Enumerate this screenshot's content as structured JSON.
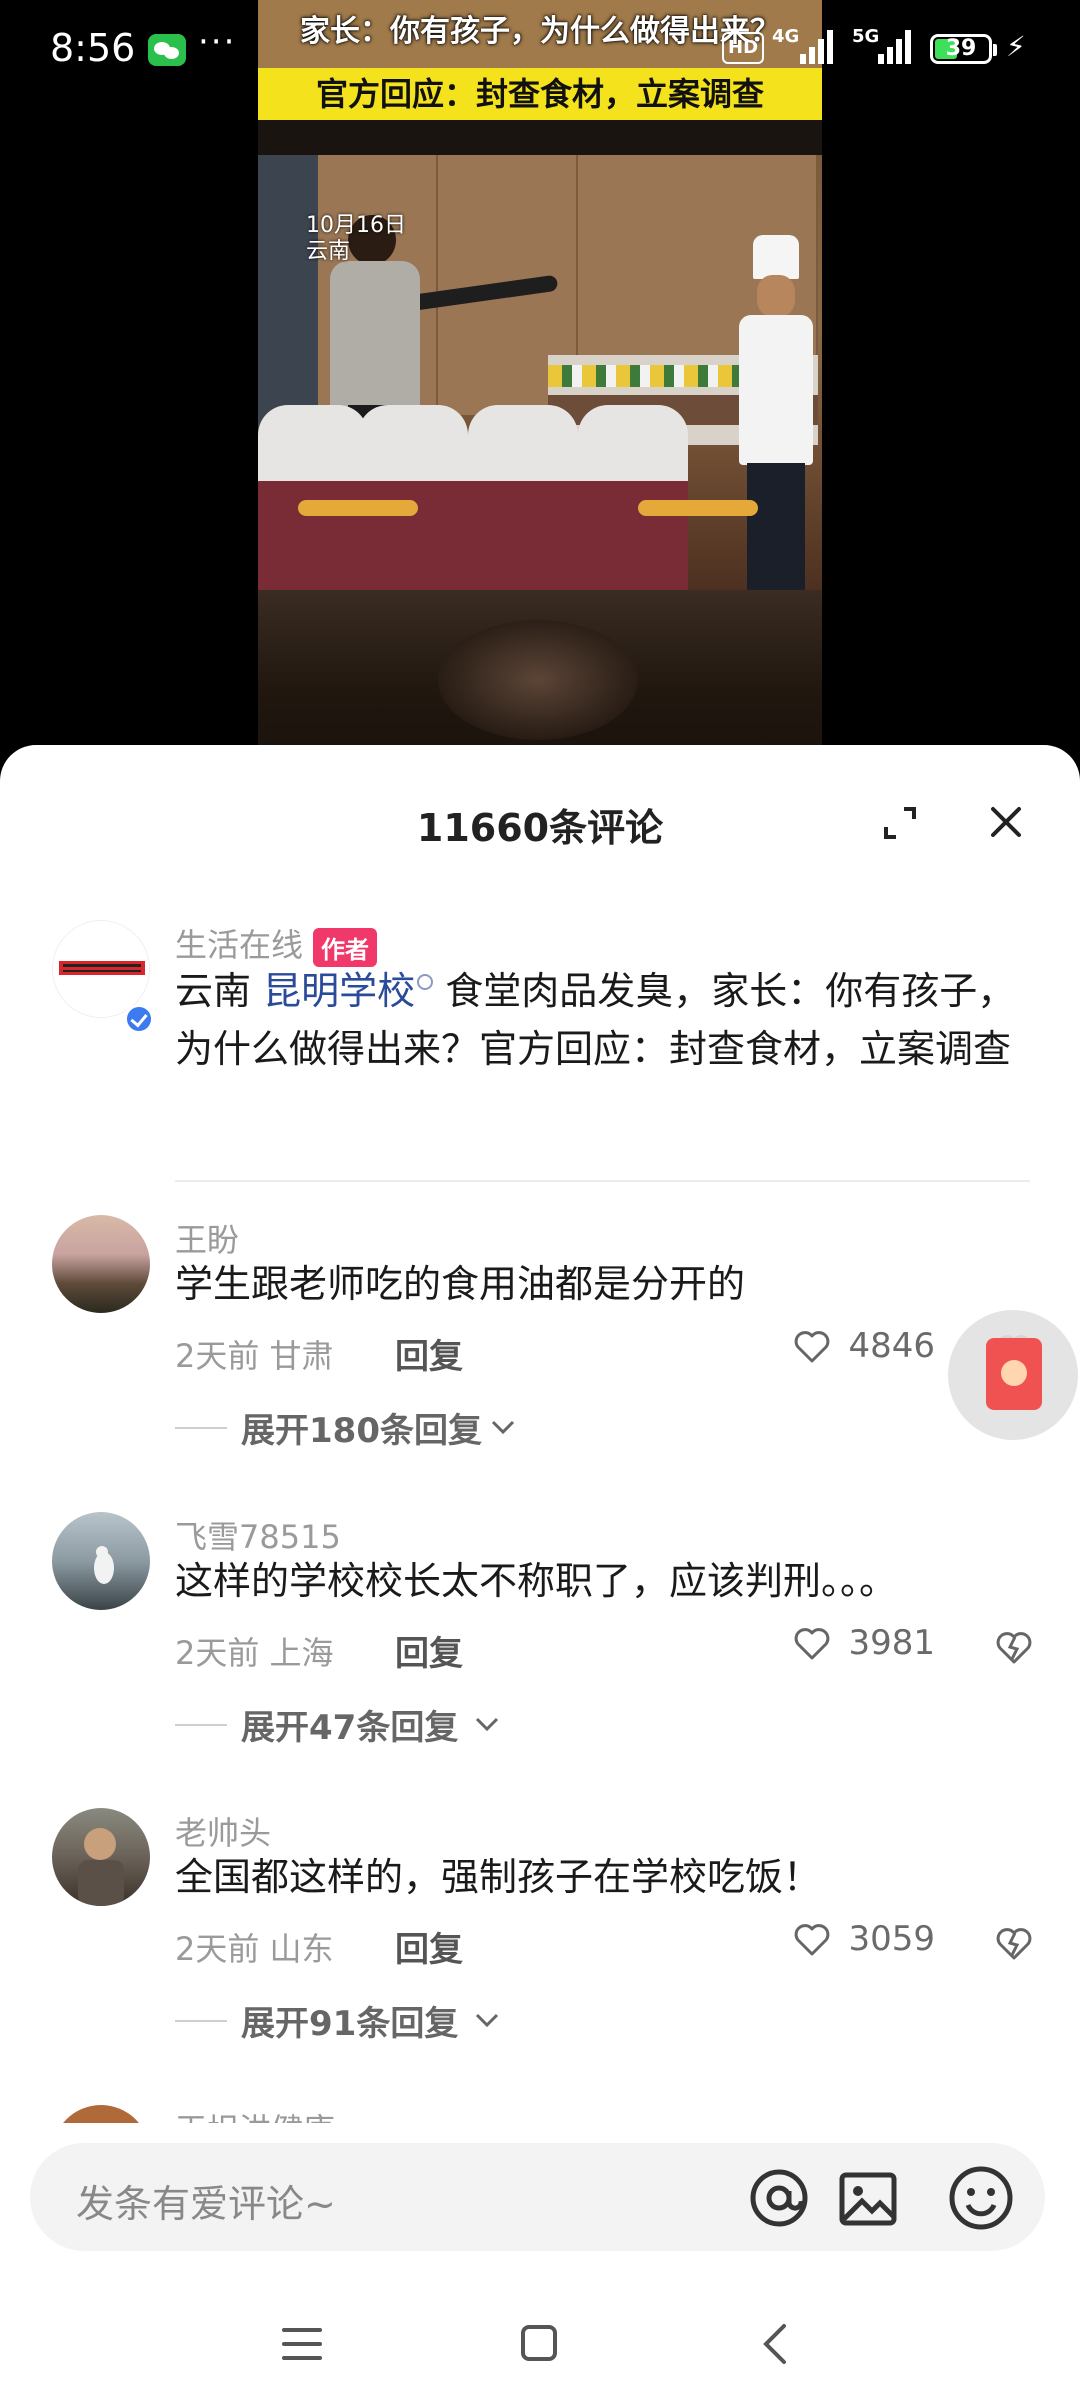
{
  "status_bar": {
    "time": "8:56",
    "network_1": "4G",
    "network_2": "5G",
    "battery": "39"
  },
  "video": {
    "headline_1": "家长：你有孩子，为什么做得出来？",
    "headline_2": "官方回应：封查食材，立案调查",
    "date": "10月16日",
    "location": "云南"
  },
  "sheet": {
    "title": "11660条评论"
  },
  "author_post": {
    "name": "生活在线",
    "badge": "作者",
    "text_prefix": "云南 ",
    "link": "昆明学校",
    "text_suffix": " 食堂肉品发臭，家长：你有孩子，为什么做得出来？官方回应：封查食材，立案调查"
  },
  "comments": [
    {
      "name": "王盼",
      "text": "学生跟老师吃的食用油都是分开的",
      "time_loc": "2天前 甘肃",
      "reply": "回复",
      "likes": "4846",
      "expand": "展开180条回复"
    },
    {
      "name": "飞雪78515",
      "text": "这样的学校校长太不称职了，应该判刑。。。",
      "time_loc": "2天前 上海",
      "reply": "回复",
      "likes": "3981",
      "expand": "展开47条回复"
    },
    {
      "name": "老帅头",
      "text": "全国都这样的，强制孩子在学校吃饭！",
      "time_loc": "2天前 山东",
      "reply": "回复",
      "likes": "3059",
      "expand": "展开91条回复"
    }
  ],
  "partial_next_name": "王坦洪健康",
  "input": {
    "placeholder": "发条有爱评论~"
  },
  "colors": {
    "accent_badge": "#f0386b",
    "link": "#2a4a9a",
    "verified": "#3b7bef",
    "headline_bar": "#f4e21c"
  },
  "icons": [
    "wechat-icon",
    "expand-icon",
    "close-icon",
    "heart-icon",
    "dislike-icon",
    "chevron-down-icon",
    "at-icon",
    "image-icon",
    "emoji-icon",
    "red-packet-icon",
    "menu-icon",
    "home-icon",
    "back-icon"
  ]
}
